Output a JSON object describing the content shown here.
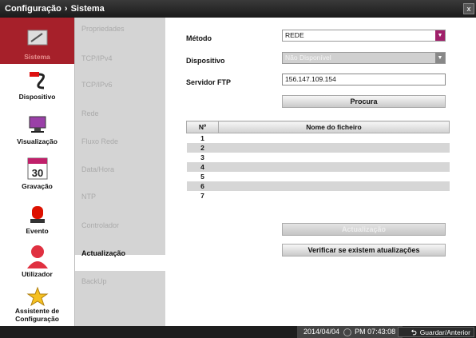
{
  "title": {
    "section": "Configuração",
    "sep": "›",
    "page": "Sistema"
  },
  "close_label": "x",
  "nav": [
    {
      "label": "Sistema",
      "icon": "toolbox-icon"
    },
    {
      "label": "Dispositivo",
      "icon": "cable-icon"
    },
    {
      "label": "Visualização",
      "icon": "monitor-icon"
    },
    {
      "label": "Gravação",
      "icon": "calendar-icon"
    },
    {
      "label": "Evento",
      "icon": "siren-icon"
    },
    {
      "label": "Utilizador",
      "icon": "user-icon"
    },
    {
      "label": "Assistente de Configuração",
      "icon": "wizard-star-icon"
    }
  ],
  "subnav": [
    "Propriedades",
    "TCP/IPv4",
    "TCP/IPv6",
    "Rede",
    "Fluxo Rede",
    "Data/Hora",
    "NTP",
    "Controlador",
    "Actualização",
    "BackUp"
  ],
  "form": {
    "metodo_label": "Método",
    "metodo_value": "REDE",
    "dispositivo_label": "Dispositivo",
    "dispositivo_value": "Não Disponível",
    "ftp_label": "Servidor FTP",
    "ftp_value": "156.147.109.154",
    "search_label": "Procura"
  },
  "table": {
    "col_no": "Nº",
    "col_name": "Nome do ficheiro",
    "rows": [
      "1",
      "2",
      "3",
      "4",
      "5",
      "6",
      "7"
    ]
  },
  "buttons": {
    "update": "Actualização",
    "check": "Verificar se existem atualizações"
  },
  "status": {
    "date": "2014/04/04",
    "time": "PM 07:43:08",
    "save": "Guardar/Anterior"
  },
  "colors": {
    "accent": "#a0206a",
    "active_nav": "#a6202a"
  }
}
